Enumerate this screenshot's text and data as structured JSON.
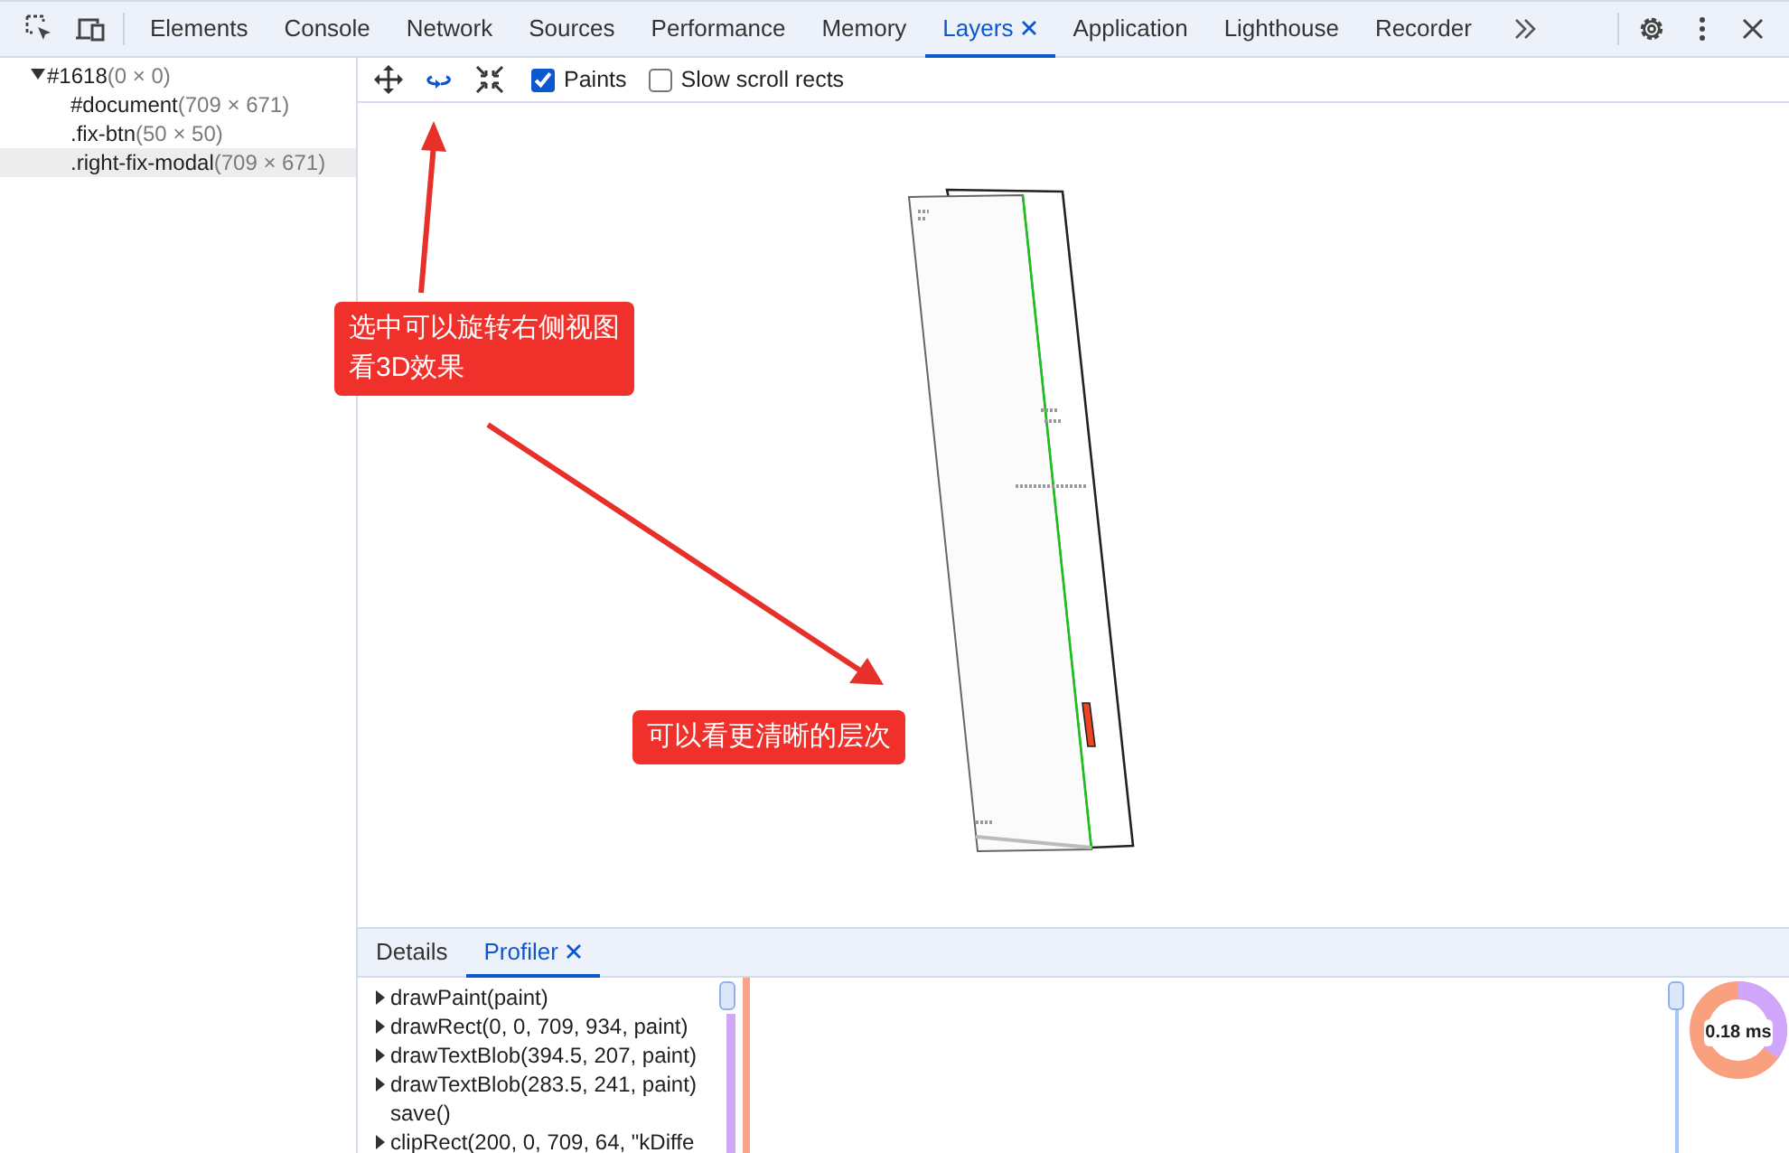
{
  "main_tabs": [
    {
      "label": "Elements",
      "selected": false,
      "closable": false
    },
    {
      "label": "Console",
      "selected": false,
      "closable": false
    },
    {
      "label": "Network",
      "selected": false,
      "closable": false
    },
    {
      "label": "Sources",
      "selected": false,
      "closable": false
    },
    {
      "label": "Performance",
      "selected": false,
      "closable": false
    },
    {
      "label": "Memory",
      "selected": false,
      "closable": false
    },
    {
      "label": "Layers",
      "selected": true,
      "closable": true
    },
    {
      "label": "Application",
      "selected": false,
      "closable": false
    },
    {
      "label": "Lighthouse",
      "selected": false,
      "closable": false
    },
    {
      "label": "Recorder",
      "selected": false,
      "closable": false
    }
  ],
  "layer_tree": [
    {
      "name": "#1618",
      "size": "(0 × 0)",
      "expanded": true,
      "selected": false,
      "children": [
        {
          "name": "#document",
          "size": "(709 × 671)",
          "selected": false
        },
        {
          "name": ".fix-btn",
          "size": "(50 × 50)",
          "selected": false
        },
        {
          "name": ".right-fix-modal",
          "size": "(709 × 671)",
          "selected": true
        }
      ]
    }
  ],
  "layer_tools": [
    {
      "kind": "pan",
      "selected": false
    },
    {
      "kind": "rotate",
      "selected": true
    },
    {
      "kind": "reset",
      "selected": false
    }
  ],
  "options": [
    {
      "label": "Paints",
      "checked": true
    },
    {
      "label": "Slow scroll rects",
      "checked": false
    }
  ],
  "annotations": [
    {
      "lines": [
        "选中可以旋转右侧视图",
        "看3D效果"
      ]
    },
    {
      "lines": [
        "可以看更清晰的层次"
      ]
    }
  ],
  "bottom_tabs": [
    {
      "label": "Details",
      "selected": false,
      "closable": false
    },
    {
      "label": "Profiler",
      "selected": true,
      "closable": true
    }
  ],
  "commands": [
    {
      "text": "drawPaint(paint)",
      "expandable": true
    },
    {
      "text": "drawRect(0, 0, 709, 934, paint)",
      "expandable": true
    },
    {
      "text": "drawTextBlob(394.5, 207, paint)",
      "expandable": true
    },
    {
      "text": "drawTextBlob(283.5, 241, paint)",
      "expandable": true
    },
    {
      "text": "save()",
      "expandable": false
    },
    {
      "text": "clipRect(200, 0, 709, 64, \"kDiffe",
      "expandable": true
    }
  ],
  "profile_time": "0.18 ms"
}
